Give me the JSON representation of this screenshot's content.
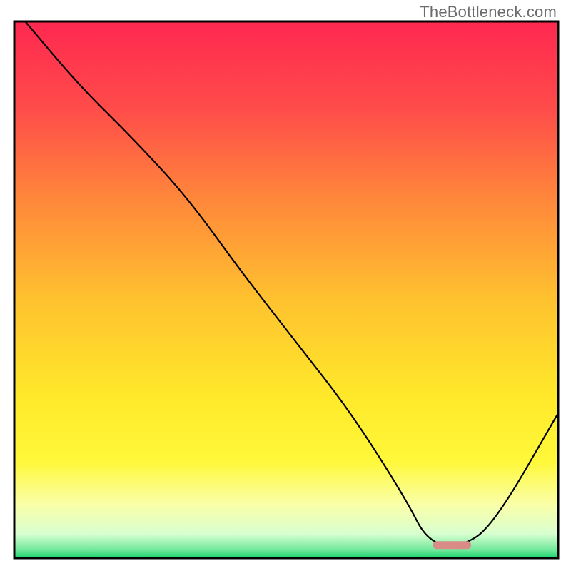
{
  "watermark": "TheBottleneck.com",
  "chart_data": {
    "type": "line",
    "title": "",
    "xlabel": "",
    "ylabel": "",
    "xlim": [
      0,
      100
    ],
    "ylim": [
      0,
      100
    ],
    "grid": false,
    "legend": false,
    "series": [
      {
        "name": "curve",
        "x": [
          2,
          12,
          22,
          32,
          42,
          52,
          62,
          72,
          76,
          82,
          88,
          100
        ],
        "y": [
          100,
          88,
          78,
          67,
          53,
          40,
          27,
          11,
          3,
          2,
          6,
          27
        ]
      }
    ],
    "marker": {
      "name": "optimum-band",
      "x_start": 77,
      "x_end": 84,
      "y": 2.5,
      "color": "#d98b87"
    },
    "background_gradient_stops": [
      {
        "pos": 0.0,
        "color": "#ff2850"
      },
      {
        "pos": 0.16,
        "color": "#ff4b4a"
      },
      {
        "pos": 0.34,
        "color": "#ff8a3a"
      },
      {
        "pos": 0.52,
        "color": "#ffc22f"
      },
      {
        "pos": 0.7,
        "color": "#ffe92a"
      },
      {
        "pos": 0.82,
        "color": "#fff83a"
      },
      {
        "pos": 0.9,
        "color": "#faffa8"
      },
      {
        "pos": 0.955,
        "color": "#d8ffd0"
      },
      {
        "pos": 0.985,
        "color": "#6fe89a"
      },
      {
        "pos": 1.0,
        "color": "#17d36b"
      }
    ],
    "axis_stroke": "#000000",
    "axis_stroke_width": 3,
    "curve_stroke": "#000000",
    "curve_stroke_width": 2.2
  }
}
